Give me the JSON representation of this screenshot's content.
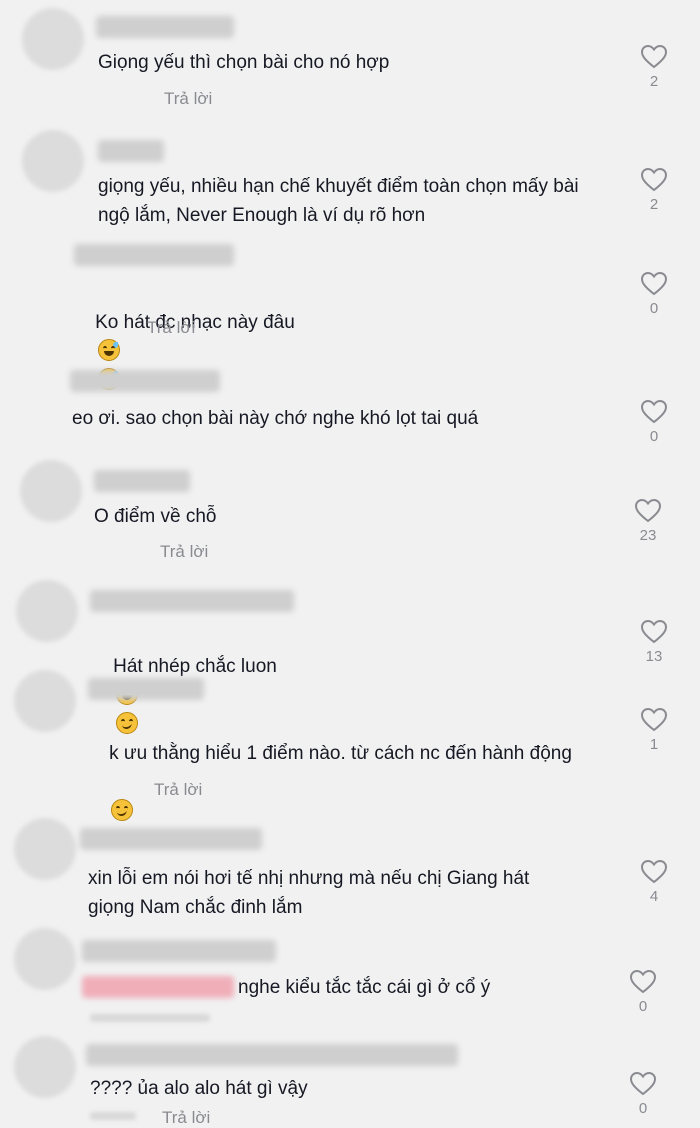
{
  "reply_label": "Trả lời",
  "colors": {
    "background": "#f1f1f1",
    "text": "#161823",
    "muted": "#8a8b91"
  },
  "comments": [
    {
      "text": "Giọng yếu thì chọn bài cho nó hợp",
      "likes": "2",
      "reply": "Trả lời"
    },
    {
      "text": "giọng yếu, nhiều hạn chế khuyết điểm toàn chọn mấy bài\nngộ lắm, Never Enough là ví dụ rõ hơn",
      "likes": "2"
    },
    {
      "text": "Ko hát đc nhạc này đâu",
      "likes": "0",
      "reply": "Trả lời",
      "emojis": [
        "sweat-smile-emoji",
        "sweat-smile-emoji"
      ]
    },
    {
      "text": "eo ơi. sao chọn bài này chớ nghe khó lọt tai quá",
      "likes": "0"
    },
    {
      "text": "O điểm về chỗ",
      "likes": "23",
      "reply": "Trả lời"
    },
    {
      "text": "Hát nhép chắc luon",
      "likes": "13",
      "emojis": [
        "sweat-smile-emoji",
        "smirk-emoji"
      ]
    },
    {
      "text": "k ưu thằng hiểu 1 điểm nào. từ cách nc đến hành động",
      "likes": "1",
      "reply": "Trả lời",
      "emojis": [
        "smirk-emoji"
      ]
    },
    {
      "text": "xin lỗi em nói hơi tế nhị nhưng mà nếu chị Giang hát\ngiọng Nam chắc đinh lắm",
      "likes": "4"
    },
    {
      "text": "nghe kiểu tắc tắc cái gì ở cổ ý",
      "likes": "0"
    },
    {
      "text": "???? ủa alo alo hát gì vậy",
      "likes": "0",
      "reply": "Trả lời"
    }
  ]
}
